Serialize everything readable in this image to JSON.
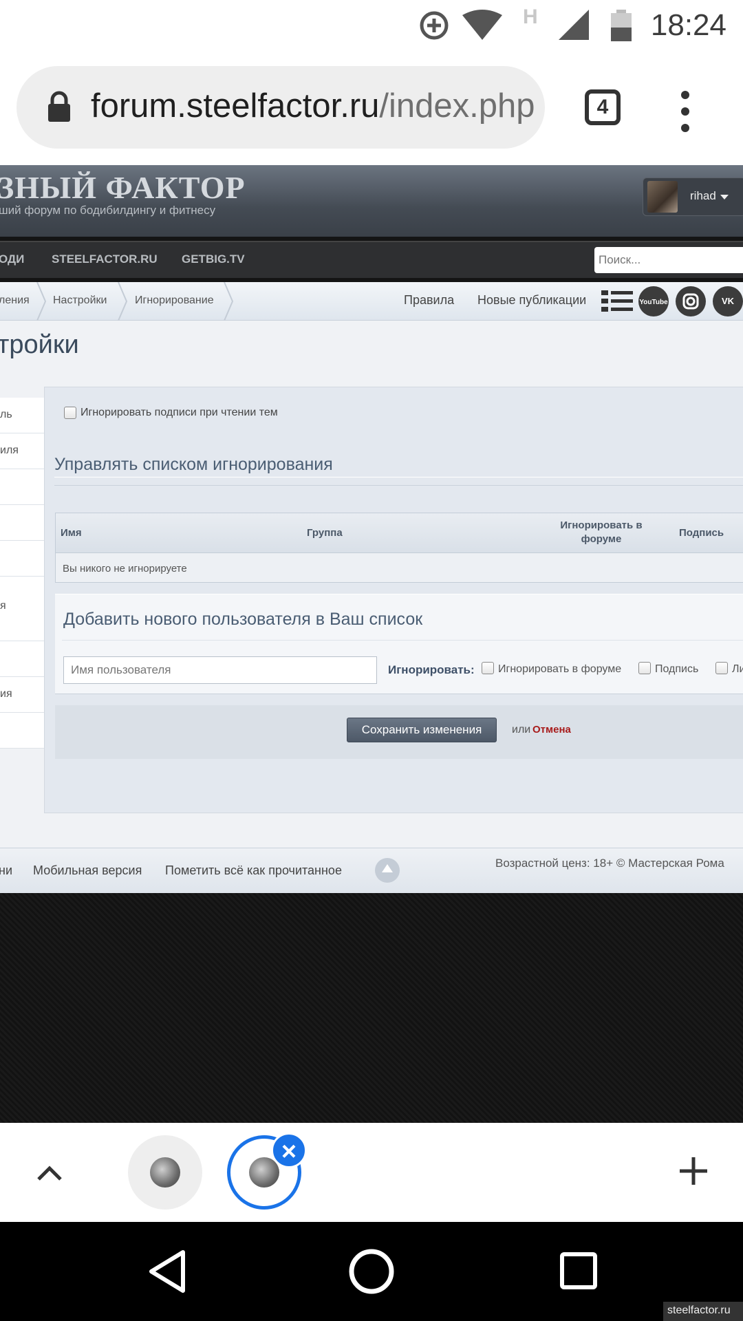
{
  "status_bar": {
    "time": "18:24",
    "network_letter": "H",
    "icons": [
      "data-saver-icon",
      "wifi-icon",
      "signal-icon",
      "battery-icon"
    ]
  },
  "browser": {
    "url_host": "forum.steelfactor.ru",
    "url_path": "/index.php",
    "tab_count": "4"
  },
  "site": {
    "logo_title": "ЗНЫЙ ФАКТОР",
    "logo_subtitle": "ший форум по бодибилдингу и фитнесу",
    "username": "rihad",
    "nav": [
      "ОДИ",
      "STEELFACTOR.RU",
      "GETBIG.TV"
    ],
    "search_placeholder": "Поиск...",
    "breadcrumbs": [
      "ления",
      "Настройки",
      "Игнорирование"
    ],
    "top_links": [
      "Правила",
      "Новые публикации"
    ],
    "social": [
      "YouTube",
      "instagram-icon",
      "vk-icon"
    ]
  },
  "page": {
    "heading": "тройки",
    "sidebar_items": [
      "ль",
      "иля",
      "",
      "",
      "",
      "я",
      "",
      "ия",
      ""
    ],
    "ignore_signatures_label": "Игнорировать подписи при чтении тем",
    "manage_title": "Управлять списком игнорирования",
    "table": {
      "columns": [
        "Имя",
        "Группа",
        "Игнорировать в форуме",
        "Подпись"
      ],
      "empty_text": "Вы никого не игнорируете"
    },
    "add_title": "Добавить нового пользователя в Ваш список",
    "username_placeholder": "Имя пользователя",
    "ignore_label": "Игнорировать:",
    "ignore_options": [
      "Игнорировать в форуме",
      "Подпись",
      "Ли"
    ],
    "save_label": "Сохранить изменения",
    "or_text": "или",
    "cancel_label": "Отмена"
  },
  "footer": {
    "links": [
      "ни",
      "Мобильная версия",
      "Пометить всё как прочитанное"
    ],
    "right_text": "Возрастной ценз: 18+ © Мастерская Рома"
  },
  "watermark": "steelfactor.ru"
}
